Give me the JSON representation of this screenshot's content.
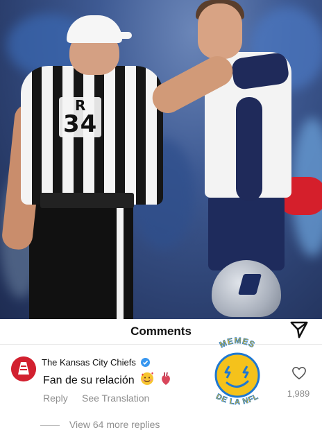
{
  "photo": {
    "referee_position": "R",
    "referee_number": "34"
  },
  "comments": {
    "title": "Comments"
  },
  "comment": {
    "author": "The Kansas City Chiefs",
    "text": "Fan de su relación",
    "reply_label": "Reply",
    "translate_label": "See Translation",
    "like_count": "1,989",
    "view_replies_label": "View 64 more replies"
  },
  "logo": {
    "top_text": "MEMES",
    "bottom_text": "DE LA NFL"
  },
  "icons": {
    "send": "send-icon",
    "verified": "verified-badge-icon",
    "like": "heart-outline-icon",
    "emoji_1": "smiling-face-with-hearts-emoji",
    "emoji_2": "anatomical-heart-emoji"
  },
  "colors": {
    "chiefs_red": "#d2202f",
    "verified_blue": "#3897f0",
    "logo_yellow": "#f5c21b",
    "logo_blue": "#1f78d1",
    "secondary_text": "#8e8e8e"
  }
}
